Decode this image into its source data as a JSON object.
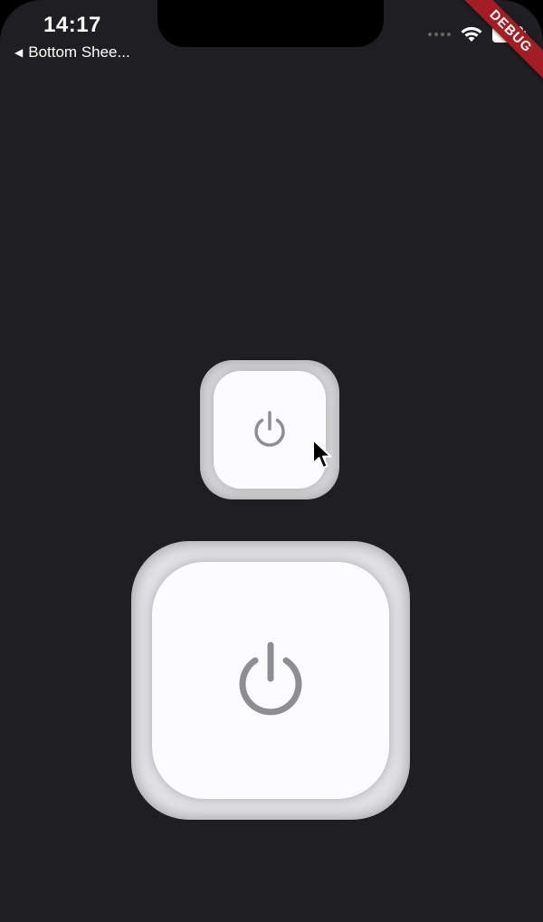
{
  "status_bar": {
    "time": "14:17",
    "back_label": "Bottom Shee...",
    "debug_label": "DEBUG"
  },
  "icons": {
    "back": "triangle-left-icon",
    "wifi": "wifi-icon",
    "battery": "battery-icon",
    "signal": "signal-dots-icon",
    "power": "power-icon",
    "cursor": "mouse-cursor-icon"
  },
  "colors": {
    "background": "#1f1e20",
    "button_face": "#fcfbfd",
    "button_well": "#e3e3e5",
    "icon": "#8e8e90",
    "debug_banner": "#a31e22"
  }
}
